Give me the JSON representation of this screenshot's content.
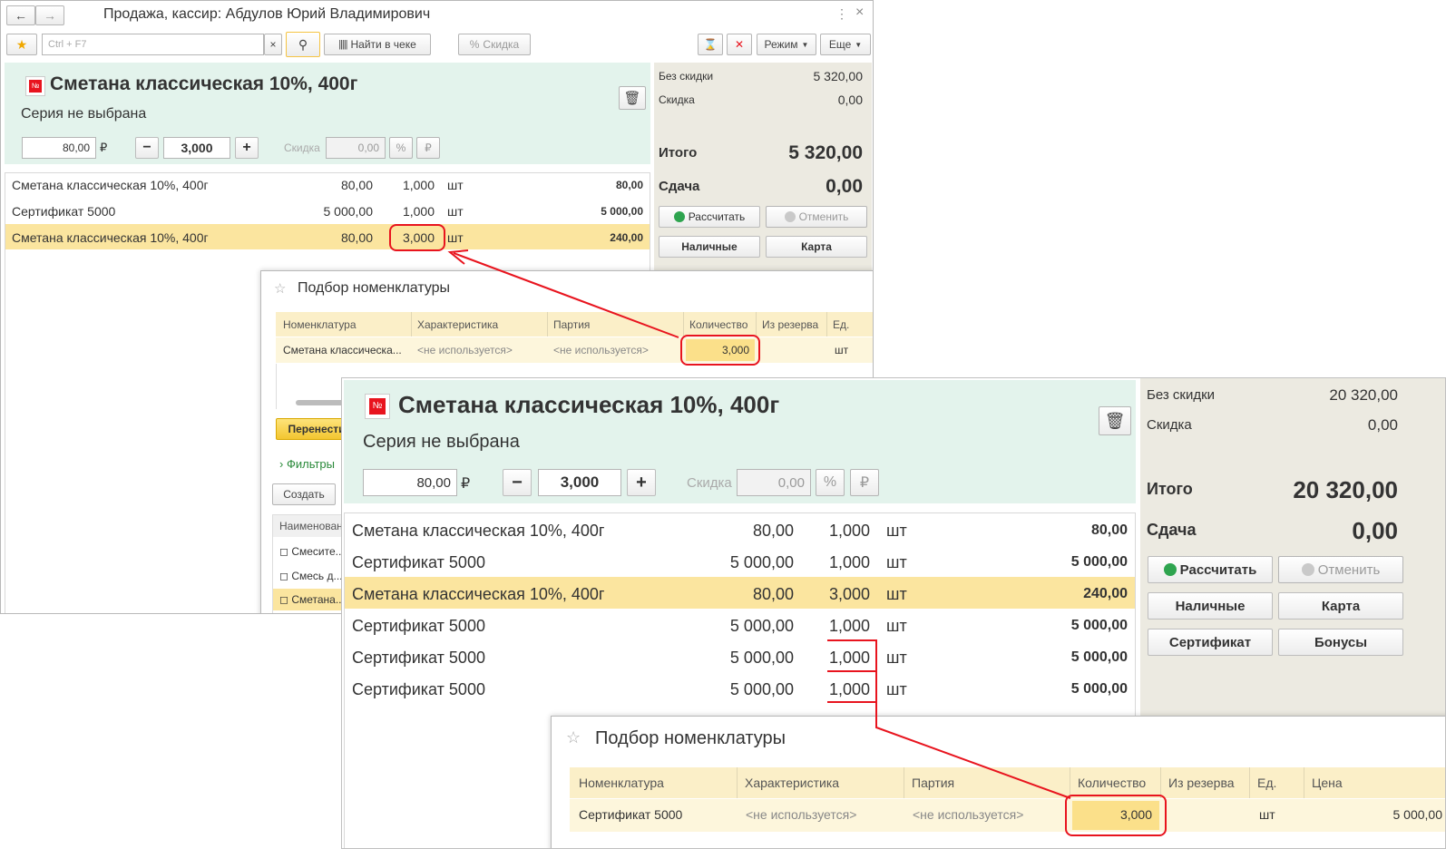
{
  "colors": {
    "accent_red": "#e8141e",
    "selection": "#fbe59f",
    "header_green": "#e3f3ec",
    "side_panel": "#eceae1",
    "grid_header": "#fbefc8"
  },
  "back": {
    "window_title": "Продажа, кассир: Абдулов Юрий Владимирович",
    "toolbar": {
      "search_placeholder": "Ctrl + F7",
      "clear_x": "×",
      "find_in_receipt": "Найти в чеке",
      "discount": "Скидка",
      "mode": "Режим",
      "more": "Еще"
    },
    "product": {
      "title": "Сметана классическая 10%, 400г",
      "series": "Серия не выбрана",
      "price": "80,00",
      "currency": "₽",
      "minus": "−",
      "qty": "3,000",
      "plus": "+",
      "discount_label": "Скидка",
      "discount_value": "0,00",
      "pct": "%",
      "rub": "₽"
    },
    "rows": [
      {
        "name": "Сметана классическая 10%, 400г",
        "price": "80,00",
        "qty": "1,000",
        "unit": "шт",
        "sum": "80,00"
      },
      {
        "name": "Сертификат 5000",
        "price": "5 000,00",
        "qty": "1,000",
        "unit": "шт",
        "sum": "5 000,00"
      },
      {
        "name": "Сметана классическая 10%, 400г",
        "price": "80,00",
        "qty": "3,000",
        "unit": "шт",
        "sum": "240,00"
      }
    ],
    "summary": {
      "no_discount_label": "Без скидки",
      "no_discount_value": "5 320,00",
      "discount_label": "Скидка",
      "discount_value": "0,00",
      "total_label": "Итого",
      "total_value": "5 320,00",
      "change_label": "Сдача",
      "change_value": "0,00",
      "calc": "Рассчитать",
      "cancel": "Отменить",
      "cash": "Наличные",
      "card": "Карта"
    },
    "picker": {
      "title": "Подбор номенклатуры",
      "columns": [
        "Номенклатура",
        "Характеристика",
        "Партия",
        "Количество",
        "Из резерва",
        "Ед."
      ],
      "row": {
        "name": "Сметана классическа...",
        "char": "<не используется>",
        "batch": "<не используется>",
        "qty": "3,000",
        "unit": "шт"
      },
      "transfer": "Перенести",
      "filters": "Фильтры",
      "create": "Создать",
      "list_header": "Наименовани",
      "list_items": [
        "Смесите...",
        "Смесь д...",
        "Сметана..."
      ]
    }
  },
  "front": {
    "product": {
      "title": "Сметана классическая 10%, 400г",
      "series": "Серия не выбрана",
      "price": "80,00",
      "currency": "₽",
      "minus": "−",
      "qty": "3,000",
      "plus": "+",
      "discount_label": "Скидка",
      "discount_value": "0,00",
      "pct": "%",
      "rub": "₽"
    },
    "rows": [
      {
        "name": "Сметана классическая 10%, 400г",
        "price": "80,00",
        "qty": "1,000",
        "unit": "шт",
        "sum": "80,00"
      },
      {
        "name": "Сертификат 5000",
        "price": "5 000,00",
        "qty": "1,000",
        "unit": "шт",
        "sum": "5 000,00"
      },
      {
        "name": "Сметана классическая 10%, 400г",
        "price": "80,00",
        "qty": "3,000",
        "unit": "шт",
        "sum": "240,00"
      },
      {
        "name": "Сертификат 5000",
        "price": "5 000,00",
        "qty": "1,000",
        "unit": "шт",
        "sum": "5 000,00"
      },
      {
        "name": "Сертификат 5000",
        "price": "5 000,00",
        "qty": "1,000",
        "unit": "шт",
        "sum": "5 000,00"
      },
      {
        "name": "Сертификат 5000",
        "price": "5 000,00",
        "qty": "1,000",
        "unit": "шт",
        "sum": "5 000,00"
      }
    ],
    "summary": {
      "no_discount_label": "Без скидки",
      "no_discount_value": "20 320,00",
      "discount_label": "Скидка",
      "discount_value": "0,00",
      "total_label": "Итого",
      "total_value": "20 320,00",
      "change_label": "Сдача",
      "change_value": "0,00",
      "calc": "Рассчитать",
      "cancel": "Отменить",
      "cash": "Наличные",
      "card": "Карта",
      "certificate": "Сертификат",
      "bonuses": "Бонусы"
    },
    "picker": {
      "title": "Подбор номенклатуры",
      "columns": [
        "Номенклатура",
        "Характеристика",
        "Партия",
        "Количество",
        "Из резерва",
        "Ед.",
        "Цена"
      ],
      "row": {
        "name": "Сертификат 5000",
        "char": "<не используется>",
        "batch": "<не используется>",
        "qty": "3,000",
        "unit": "шт",
        "price": "5 000,00"
      }
    }
  }
}
